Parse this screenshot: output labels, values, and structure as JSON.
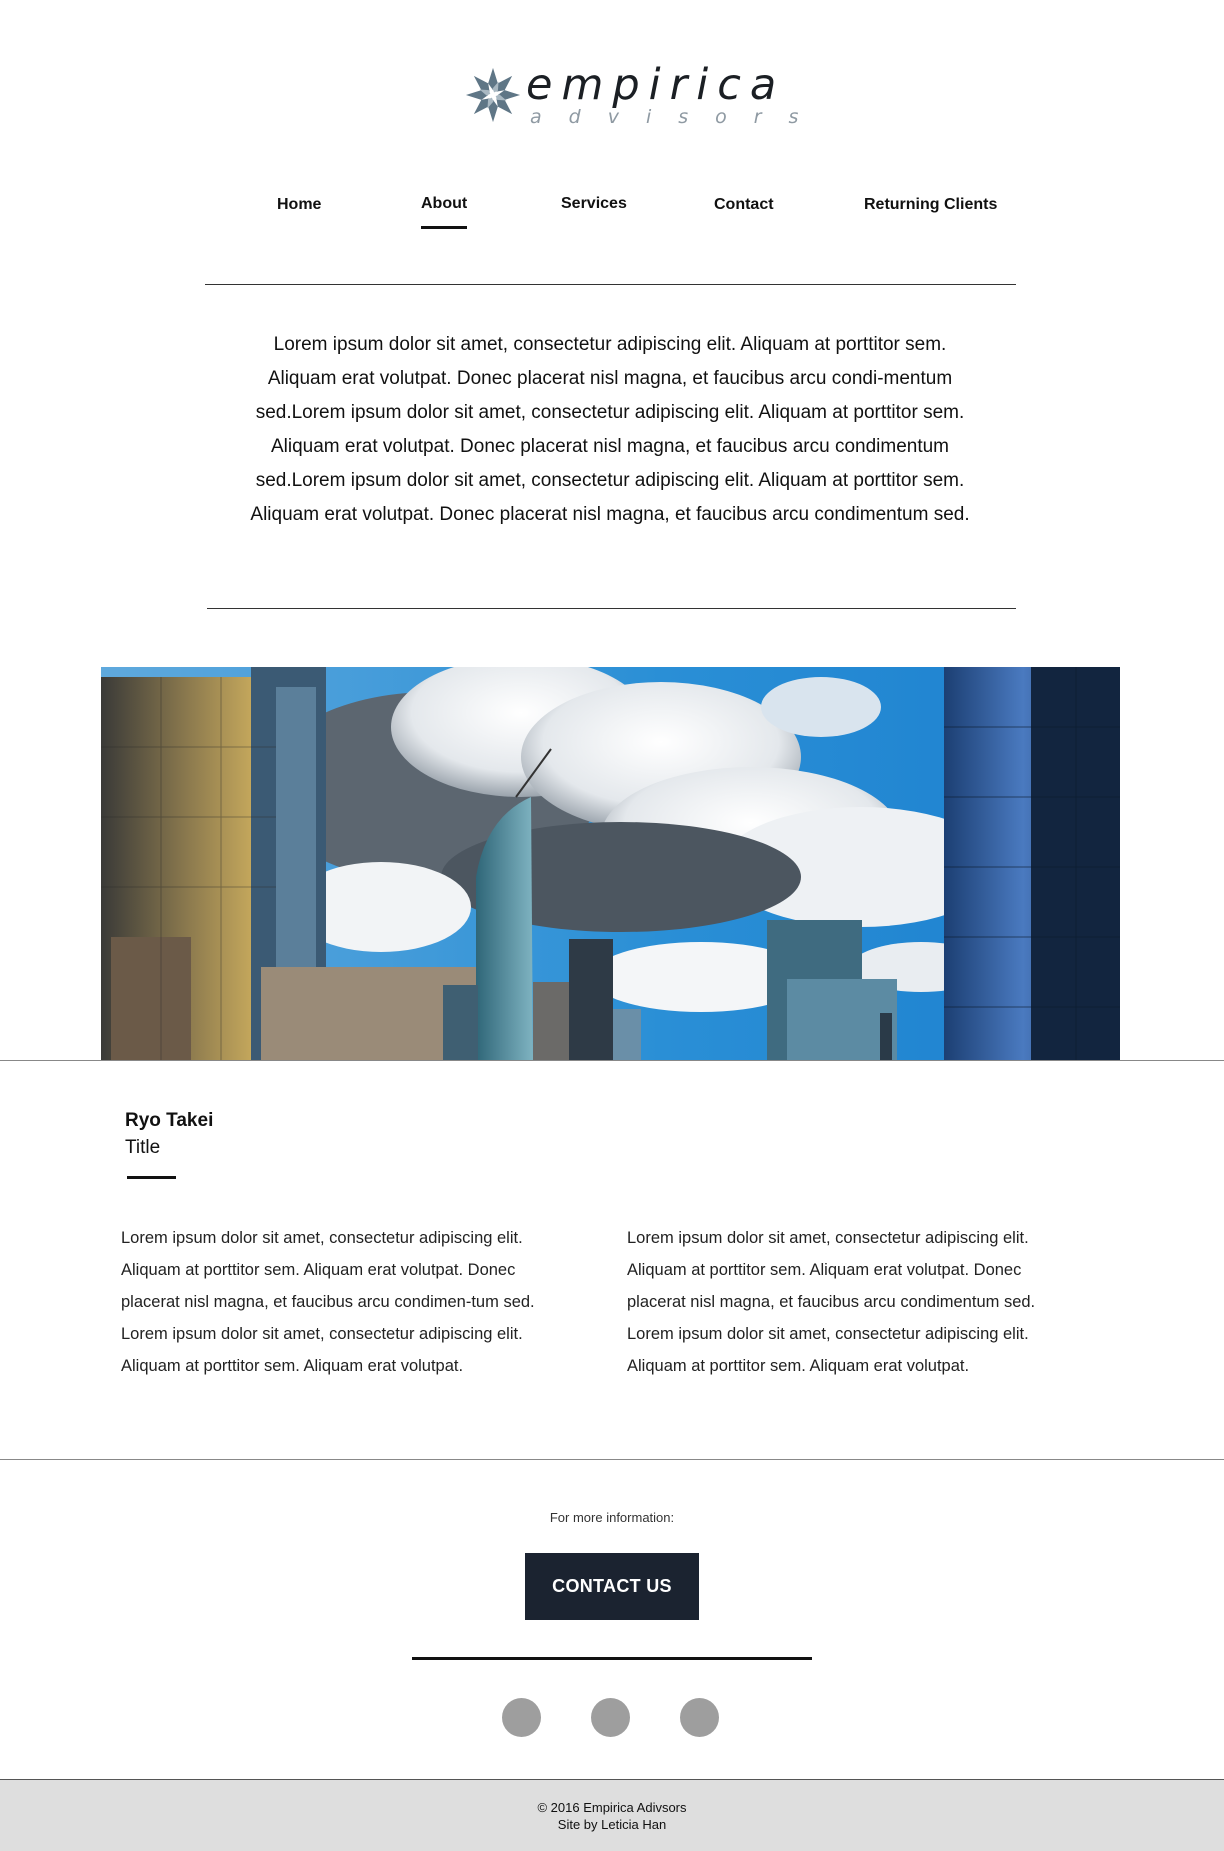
{
  "brand": {
    "name": "empirica",
    "tagline": "advisors",
    "logo_icon": "flower-star-icon",
    "logo_color": "#5f7686"
  },
  "nav": {
    "items": [
      {
        "label": "Home",
        "active": false
      },
      {
        "label": "About",
        "active": true
      },
      {
        "label": "Services",
        "active": false
      },
      {
        "label": "Contact",
        "active": false
      },
      {
        "label": "Returning Clients",
        "active": false
      }
    ]
  },
  "intro": {
    "text": "Lorem ipsum dolor sit amet, consectetur adipiscing elit. Aliquam at porttitor sem.  Aliquam erat volutpat. Donec placerat nisl magna, et faucibus arcu condi-mentum sed.Lorem ipsum dolor sit amet, consectetur adipiscing elit. Aliquam at porttitor sem.  Aliquam erat volutpat. Donec placerat nisl magna, et faucibus arcu condimentum sed.Lorem ipsum dolor sit amet, consectetur adipiscing elit. Aliquam at porttitor sem.  Aliquam erat volutpat. Donec placerat nisl magna, et faucibus arcu condimentum sed."
  },
  "hero": {
    "image": "city-skyline-photo",
    "sky_color": "#1f8fd8"
  },
  "profile": {
    "name": "Ryo Takei",
    "title": "Title",
    "column_left": "Lorem ipsum dolor sit amet, consectetur adipiscing elit. Aliquam at porttitor sem.  Aliquam erat volutpat. Donec placerat nisl magna, et faucibus arcu condimen-tum sed. Lorem ipsum dolor sit amet, consectetur adipiscing elit. Aliquam at porttitor sem.  Aliquam erat volutpat.",
    "column_right": "Lorem ipsum dolor sit amet, consectetur adipiscing elit. Aliquam at porttitor sem.  Aliquam erat volutpat. Donec placerat nisl magna, et faucibus arcu condimentum sed. Lorem ipsum dolor sit amet, consectetur adipiscing elit. Aliquam at porttitor sem.  Aliquam erat volutpat."
  },
  "cta": {
    "prompt": "For more information:",
    "button_label": "CONTACT US",
    "button_color": "#1b2330"
  },
  "social": {
    "icons": [
      "social-icon",
      "social-icon",
      "social-icon"
    ],
    "color": "#9e9e9e"
  },
  "footer": {
    "copyright": "© 2016 Empirica Adivsors",
    "credit": "Site by Leticia Han",
    "background": "#dedede"
  }
}
